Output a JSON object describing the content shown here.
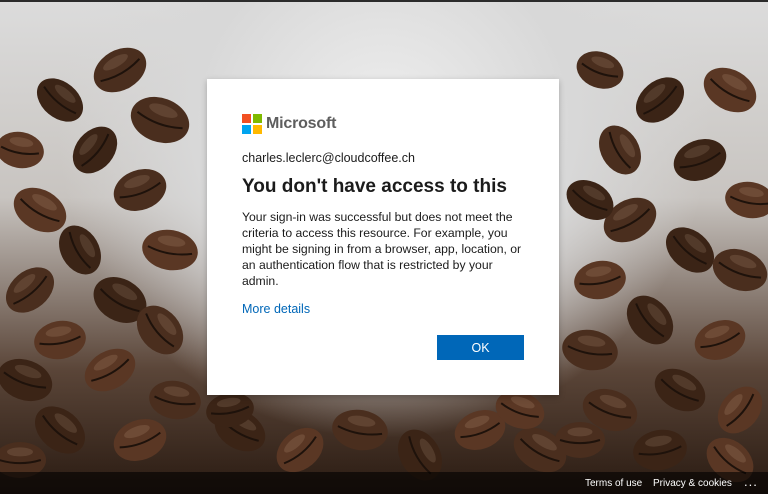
{
  "brand": {
    "name": "Microsoft",
    "colors": [
      "#f25022",
      "#7fba00",
      "#00a4ef",
      "#ffb900"
    ]
  },
  "dialog": {
    "email": "charles.leclerc@cloudcoffee.ch",
    "title": "You don't have access to this",
    "message": "Your sign-in was successful but does not meet the criteria to access this resource. For example, you might be signing in from a browser, app, location, or an authentication flow that is restricted by your admin.",
    "details_link": "More details",
    "ok_label": "OK"
  },
  "footer": {
    "terms": "Terms of use",
    "privacy": "Privacy & cookies",
    "more": "..."
  },
  "colors": {
    "accent": "#0067b8",
    "background_theme": "coffee-beans"
  }
}
